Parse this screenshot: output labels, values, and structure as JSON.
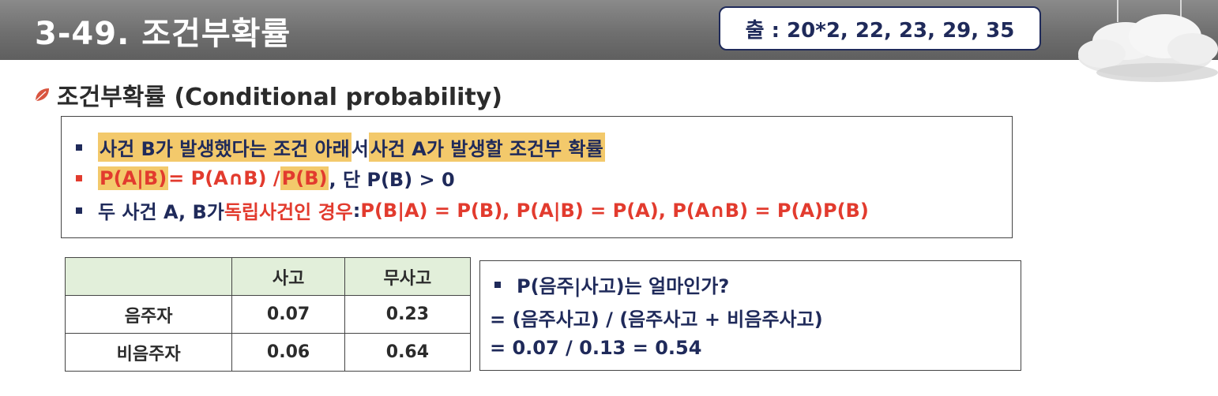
{
  "header": {
    "title": "3-49. 조건부확률",
    "source": "출 : 20*2, 22, 23, 29, 35"
  },
  "heading": "조건부확률 (Conditional probability)",
  "definitions": {
    "line1": {
      "part1": "사건 B가 발생했다는 조건 아래",
      "part2": "서 ",
      "part3": "사건 A가 발생할 조건부 확률"
    },
    "line2": {
      "part1": "P(A|B)",
      "part2": " = P(A∩B) / ",
      "part3": "P(B)",
      "part4": ", 단 P(B) > 0"
    },
    "line3": {
      "part1": "두 사건 A, B가 ",
      "part2": "독립사건인 경우",
      "part3": " : ",
      "part4": "P(B|A) = P(B), P(A|B) = P(A), P(A∩B) = P(A)P(B)"
    }
  },
  "table": {
    "headers": [
      "",
      "사고",
      "무사고"
    ],
    "rows": [
      [
        "음주자",
        "0.07",
        "0.23"
      ],
      [
        "비음주자",
        "0.06",
        "0.64"
      ]
    ]
  },
  "calculation": {
    "line1": "P(음주|사고)는 얼마인가?",
    "line2": "= (음주사고) / (음주사고 + 비음주사고)",
    "line3": "= 0.07 / 0.13 = 0.54"
  },
  "colors": {
    "navy": "#1f2a5a",
    "red": "#e23b2e",
    "highlight": "#f3c96b",
    "table_header": "#e2efda"
  }
}
